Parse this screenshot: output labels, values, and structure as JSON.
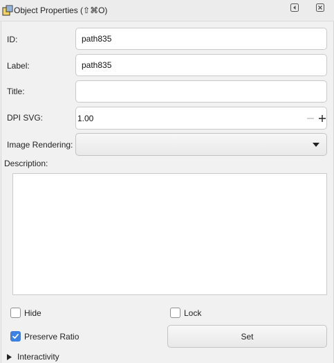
{
  "titlebar": {
    "title": "Object Properties (⇧⌘O)",
    "icon": "object-properties-icon",
    "dock_icon": "dock-icon",
    "close_icon": "close-icon"
  },
  "form": {
    "id_label": "ID:",
    "id_value": "path835",
    "label_label": "Label:",
    "label_value": "path835",
    "title_label": "Title:",
    "title_value": "",
    "dpi_label": "DPI SVG:",
    "dpi_value": "1.00",
    "dpi_minus": "−",
    "dpi_plus": "+",
    "image_rendering_label": "Image Rendering:",
    "image_rendering_value": "",
    "description_label": "Description:",
    "description_value": ""
  },
  "options": {
    "hide_label": "Hide",
    "hide_checked": false,
    "lock_label": "Lock",
    "lock_checked": false,
    "preserve_ratio_label": "Preserve Ratio",
    "preserve_ratio_checked": true,
    "set_label": "Set"
  },
  "interactivity": {
    "label": "Interactivity",
    "expanded": false
  },
  "colors": {
    "accent": "#3b82e6",
    "panel_bg": "#f1f1f1",
    "field_border": "#c9c9c9"
  }
}
